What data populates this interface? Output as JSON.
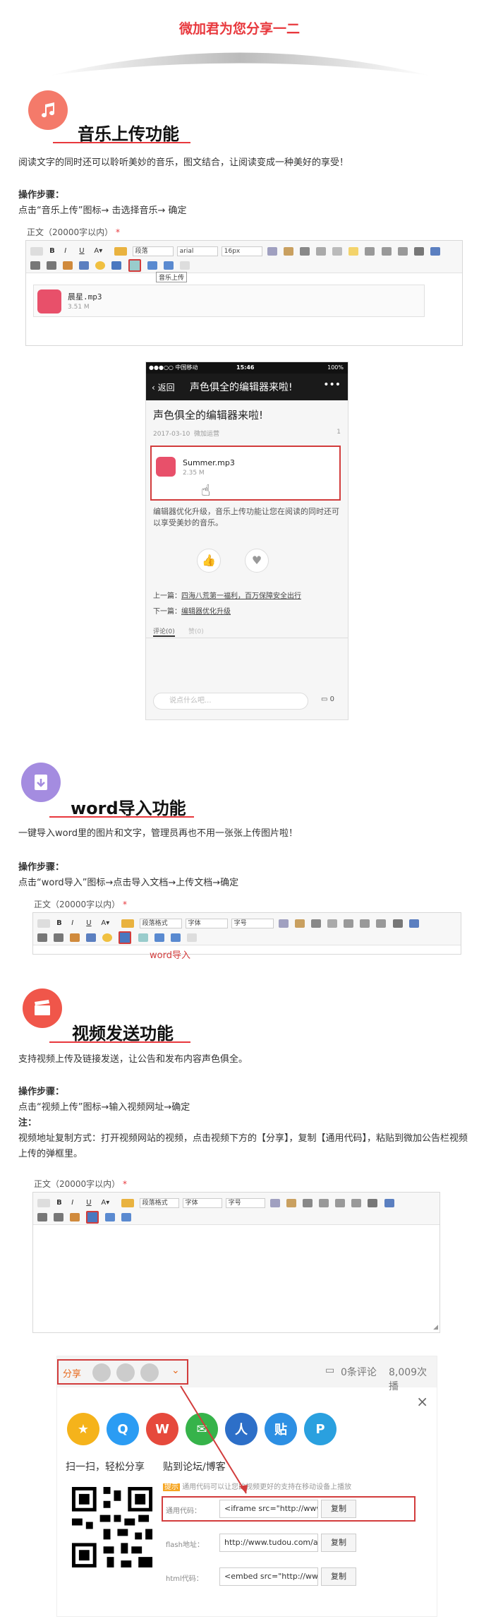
{
  "header": {
    "title": "微加君为您分享一二"
  },
  "music": {
    "title": "音乐上传功能",
    "desc": "阅读文字的同时还可以聆听美妙的音乐，图文结合，让阅读变成一种美好的享受！",
    "steps_label": "操作步骤：",
    "steps": "点击“音乐上传”图标→ 击选择音乐→ 确定",
    "editor_label": "正文（20000字以内）",
    "req": "*",
    "font_style": "段落",
    "font_family": "arial",
    "font_size": "16px",
    "tooltip": "音乐上传",
    "file_name": "晨星.mp3",
    "file_size": "3.51 M"
  },
  "phone": {
    "carrier": "●●●○○ 中国移动",
    "time": "15:46",
    "battery": "100%",
    "back": "返回",
    "nav_title": "声色俱全的编辑器来啦!",
    "more": "•••",
    "article_title": "声色俱全的编辑器来啦!",
    "date": "2017-03-10",
    "author": "微加运营",
    "views": "1",
    "file_name": "Summer.mp3",
    "file_size": "2.35 M",
    "body": "编辑器优化升级，音乐上传功能让您在阅读的同时还可以享受美妙的音乐。",
    "prev_label": "上一篇：",
    "prev_link": "四海八荒第一福利，百万保障安全出行",
    "next_label": "下一篇：",
    "next_link": "编辑器优化升级",
    "tab_comment": "评论(0)",
    "tab_like": "赞(0)",
    "comment_placeholder": "说点什么吧...",
    "comment_count": "0"
  },
  "word": {
    "title": "word导入功能",
    "desc": "一键导入word里的图片和文字，管理员再也不用一张张上传图片啦！",
    "steps_label": "操作步骤：",
    "steps": "点击“word导入”图标→点击导入文档→上传文档→确定",
    "editor_label": "正文（20000字以内）",
    "req": "*",
    "font_style": "段落格式",
    "font_family": "字体",
    "font_size": "字号",
    "tooltip": "word导入"
  },
  "video": {
    "title": "视频发送功能",
    "desc": "支持视频上传及链接发送，让公告和发布内容声色俱全。",
    "steps_label": "操作步骤：",
    "steps": "点击“视频上传”图标→输入视频网址→确定",
    "note_label": "注：",
    "note": "视频地址复制方式：打开视频网站的视频，点击视频下方的【分享】，复制【通用代码】，粘贴到微加公告栏视频上传的弹框里。",
    "editor_label": "正文（20000字以内）",
    "req": "*",
    "font_style": "段落格式",
    "font_family": "字体",
    "font_size": "字号"
  },
  "share": {
    "label": "分享",
    "comments": "0条评论",
    "plays": "8,009次播",
    "close": "×",
    "scan_title": "扫一扫，轻松分享",
    "bbs_title": "贴到论坛/博客",
    "tip_badge": "提示",
    "tip": "通用代码可以让您的视频更好的支持在移动设备上播放",
    "rows": [
      {
        "label": "通用代码：",
        "value": "<iframe src=\"http://www.tudou.",
        "button": "复制"
      },
      {
        "label": "flash地址：",
        "value": "http://www.tudou.com/a/GW_E",
        "button": "复制"
      },
      {
        "label": "html代码：",
        "value": "<embed src=\"http://www.tudou",
        "button": "复制"
      }
    ]
  }
}
